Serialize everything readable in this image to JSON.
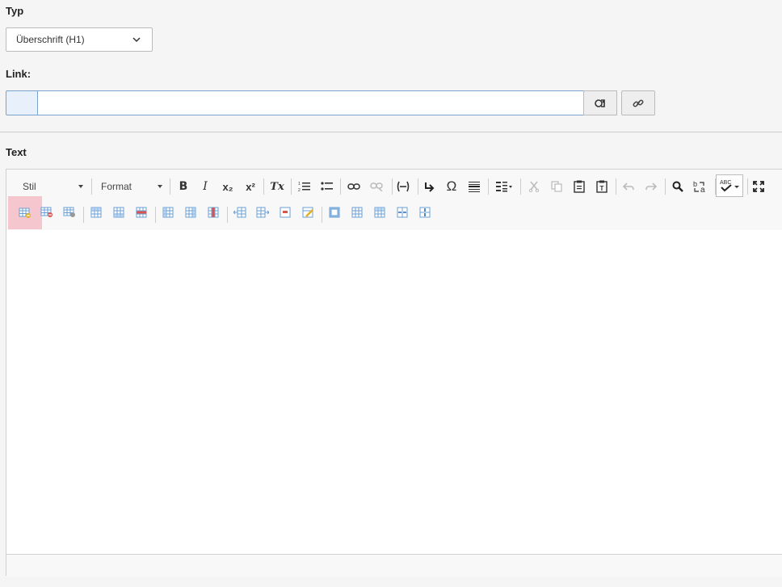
{
  "typ": {
    "label": "Typ",
    "value": "Überschrift (H1)"
  },
  "link": {
    "label": "Link:",
    "value": ""
  },
  "text": {
    "label": "Text"
  },
  "toolbar": {
    "style_label": "Stil",
    "format_label": "Format"
  },
  "icons": {
    "bold": "B",
    "italic": "I",
    "subscript": "x₂",
    "superscript": "x²",
    "remove_format": "Tx",
    "numbered_list": "numbered-list-icon",
    "bulleted_list": "bulleted-list-icon",
    "omega": "Ω"
  },
  "colors": {
    "accent_border": "#7aa3cf",
    "active_button": "#f6c6cf",
    "table_blue": "#6a9fd4"
  }
}
